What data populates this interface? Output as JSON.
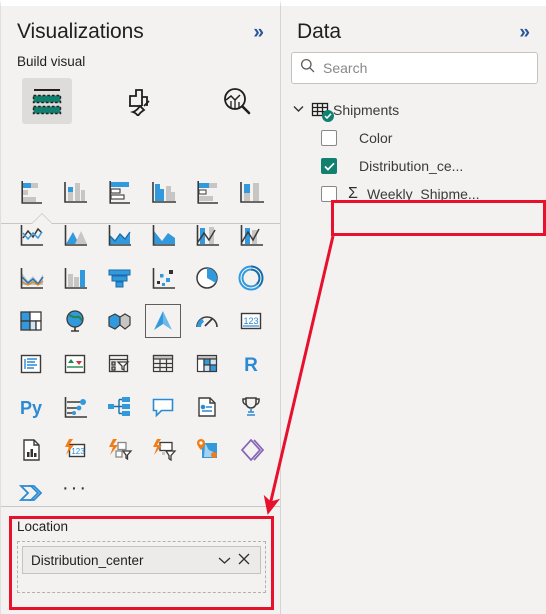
{
  "visualizations": {
    "title": "Visualizations",
    "collapse_label": "»",
    "build_visual_label": "Build visual",
    "tabs": [
      {
        "name": "build",
        "label": "Build visual",
        "selected": true
      },
      {
        "name": "format",
        "label": "Format visual",
        "selected": false
      },
      {
        "name": "analytics",
        "label": "Analytics",
        "selected": false
      }
    ],
    "gallery": [
      {
        "name": "stacked-bar-chart-icon",
        "selected": false
      },
      {
        "name": "stacked-column-chart-icon",
        "selected": false
      },
      {
        "name": "clustered-bar-chart-icon",
        "selected": false
      },
      {
        "name": "clustered-column-chart-icon",
        "selected": false
      },
      {
        "name": "hundred-percent-stacked-bar-chart-icon",
        "selected": false
      },
      {
        "name": "hundred-percent-stacked-column-chart-icon",
        "selected": false
      },
      {
        "name": "line-chart-icon",
        "selected": false
      },
      {
        "name": "area-chart-icon",
        "selected": false
      },
      {
        "name": "stacked-area-chart-icon",
        "selected": false
      },
      {
        "name": "line-and-stacked-column-chart-icon",
        "selected": false
      },
      {
        "name": "line-and-clustered-column-chart-icon",
        "selected": false
      },
      {
        "name": "ribbon-chart-icon",
        "selected": false
      },
      {
        "name": "waterfall-chart-icon",
        "selected": false
      },
      {
        "name": "funnel-chart-icon",
        "selected": false
      },
      {
        "name": "scatter-chart-icon",
        "selected": false
      },
      {
        "name": "pie-chart-icon",
        "selected": false
      },
      {
        "name": "donut-chart-icon",
        "selected": false
      },
      {
        "name": "treemap-icon",
        "selected": false
      },
      {
        "name": "map-icon",
        "selected": false
      },
      {
        "name": "filled-map-icon",
        "selected": false
      },
      {
        "name": "azure-map-icon",
        "selected": true
      },
      {
        "name": "gauge-icon",
        "selected": false
      },
      {
        "name": "card-number-icon",
        "selected": false
      },
      {
        "name": "multi-row-card-icon",
        "selected": false
      },
      {
        "name": "kpi-icon",
        "selected": false
      },
      {
        "name": "slicer-icon",
        "selected": false
      },
      {
        "name": "table-icon",
        "selected": false
      },
      {
        "name": "matrix-icon",
        "selected": false
      },
      {
        "name": "r-script-visual-icon",
        "selected": false
      },
      {
        "name": "python-visual-icon",
        "selected": false
      },
      {
        "name": "key-influencers-icon",
        "selected": false
      },
      {
        "name": "decomposition-tree-icon",
        "selected": false
      },
      {
        "name": "q-and-a-icon",
        "selected": false
      },
      {
        "name": "smart-narrative-icon",
        "selected": false
      },
      {
        "name": "metrics-icon",
        "selected": false
      },
      {
        "name": "paginated-report-icon",
        "selected": false
      },
      {
        "name": "power-apps-card-icon",
        "selected": false
      },
      {
        "name": "power-automate-slicer-icon",
        "selected": false
      },
      {
        "name": "power-automate-filter-icon",
        "selected": false
      },
      {
        "name": "arcgis-map-icon",
        "selected": false
      },
      {
        "name": "visio-visual-icon",
        "selected": false
      },
      {
        "name": "power-automate-visual-icon",
        "selected": false
      },
      {
        "name": "more-options-icon",
        "selected": false
      }
    ],
    "wells": [
      {
        "name": "location",
        "title": "Location",
        "fields": [
          {
            "label": "Distribution_center",
            "dropdown_icon": "chevron-down-icon",
            "remove_icon": "close-icon"
          }
        ]
      }
    ]
  },
  "data": {
    "title": "Data",
    "collapse_label": "»",
    "search": {
      "placeholder": "Search",
      "value": "",
      "icon": "search-icon"
    },
    "tree": [
      {
        "name": "shipments",
        "label": "Shipments",
        "type": "table",
        "expanded": true,
        "twisty": "∨",
        "children": [
          {
            "name": "color",
            "label": "Color",
            "checked": false,
            "measure": false
          },
          {
            "name": "distribution-center",
            "label": "Distribution_ce...",
            "checked": true,
            "measure": false,
            "highlighted": true
          },
          {
            "name": "weekly-shipments",
            "label": "Weekly_Shipme...",
            "checked": false,
            "measure": true,
            "sigma": "Σ"
          }
        ]
      }
    ]
  },
  "annotations": {
    "highlight_color": "#e8112d",
    "boxes": [
      {
        "name": "field-highlight",
        "target": "Distribution_ce..."
      },
      {
        "name": "location-well-highlight",
        "target": "Location"
      }
    ],
    "arrow": {
      "name": "annotation-arrow",
      "from": "Distribution_ce...",
      "to": "Location"
    }
  }
}
